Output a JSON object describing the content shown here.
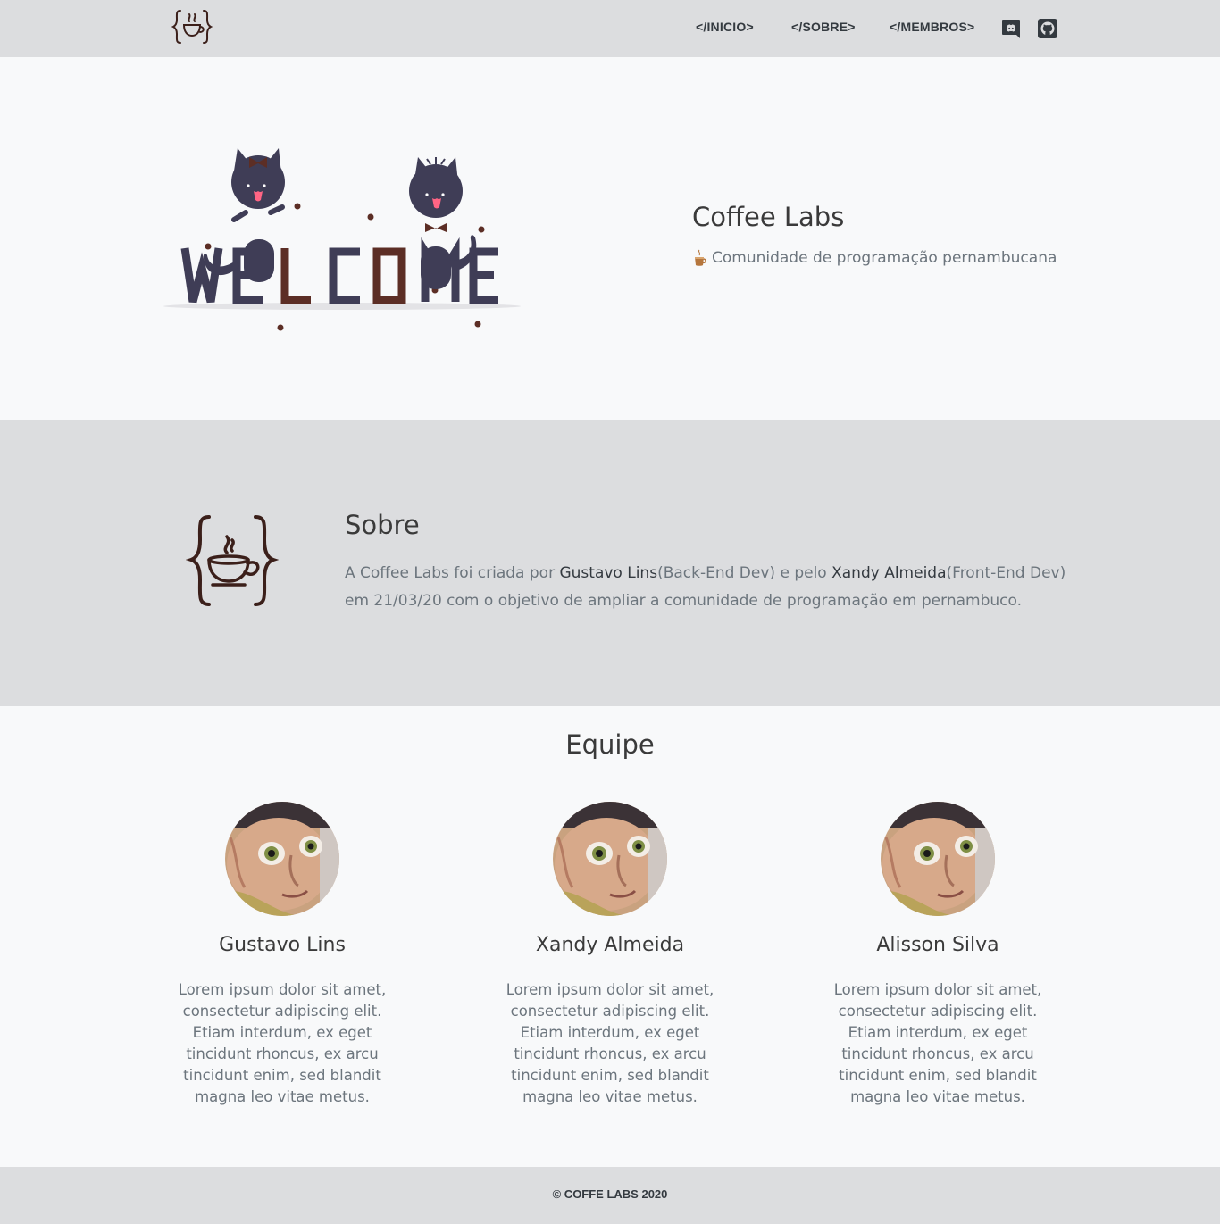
{
  "nav": {
    "logo_icon": "coffee-braces-logo-icon",
    "links": [
      "</INICIO>",
      "</SOBRE>",
      "</MEMBROS>"
    ],
    "social_icons": [
      "discord-icon",
      "github-icon"
    ]
  },
  "hero": {
    "title": "Coffee Labs",
    "subtitle": "Comunidade de programação pernambucana",
    "subtitle_icon": "coffee-cup-icon",
    "illustration": "welcome-cats-illustration"
  },
  "sobre": {
    "title": "Sobre",
    "text_1": "A Coffee Labs foi criada por ",
    "name_1": "Gustavo Lins",
    "text_2": "(Back-End Dev) e pelo ",
    "name_2": "Xandy Almeida",
    "text_3": "(Front-End Dev) em 21/03/20 com o objetivo de ampliar a comunidade de programação em pernambuco."
  },
  "equipe": {
    "title": "Equipe",
    "members": [
      {
        "name": "Gustavo Lins",
        "bio": "Lorem ipsum dolor sit amet, consectetur adipiscing elit. Etiam interdum, ex eget tincidunt rhoncus, ex arcu tincidunt enim, sed blandit magna leo vitae metus."
      },
      {
        "name": "Xandy Almeida",
        "bio": "Lorem ipsum dolor sit amet, consectetur adipiscing elit. Etiam interdum, ex eget tincidunt rhoncus, ex arcu tincidunt enim, sed blandit magna leo vitae metus."
      },
      {
        "name": "Alisson Silva",
        "bio": "Lorem ipsum dolor sit amet, consectetur adipiscing elit. Etiam interdum, ex eget tincidunt rhoncus, ex arcu tincidunt enim, sed blandit magna leo vitae metus."
      }
    ]
  },
  "footer": {
    "text": "© COFFE LABS 2020"
  },
  "colors": {
    "navbar_bg": "#dcdddf",
    "page_bg": "#f8f9fa",
    "brown": "#5c2e25",
    "dark_navy": "#3f3d56",
    "text_gray": "#6c757d"
  }
}
